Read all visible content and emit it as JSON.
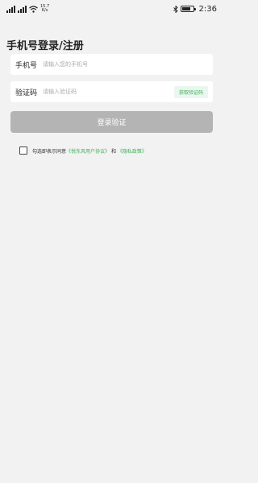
{
  "status_bar": {
    "net_speed": "15.7",
    "net_unit": "K/s",
    "time": "2:36",
    "battery_level": 0.8
  },
  "page": {
    "title": "手机号登录/注册"
  },
  "phone": {
    "label": "手机号",
    "placeholder": "请输入您的手机号"
  },
  "code": {
    "label": "验证码",
    "placeholder": "请输入验证码",
    "get_code_label": "获取验证码"
  },
  "submit": {
    "label": "登录验证"
  },
  "agreement": {
    "prefix": "勾选即表示同意",
    "user_agreement": "《悦东风用户协议》",
    "conjunction": "和",
    "privacy_policy": "《隐私政策》",
    "checked": false
  },
  "colors": {
    "accent": "#3db15a",
    "button_disabled": "#b4b4b4",
    "background": "#f2f2f2"
  }
}
